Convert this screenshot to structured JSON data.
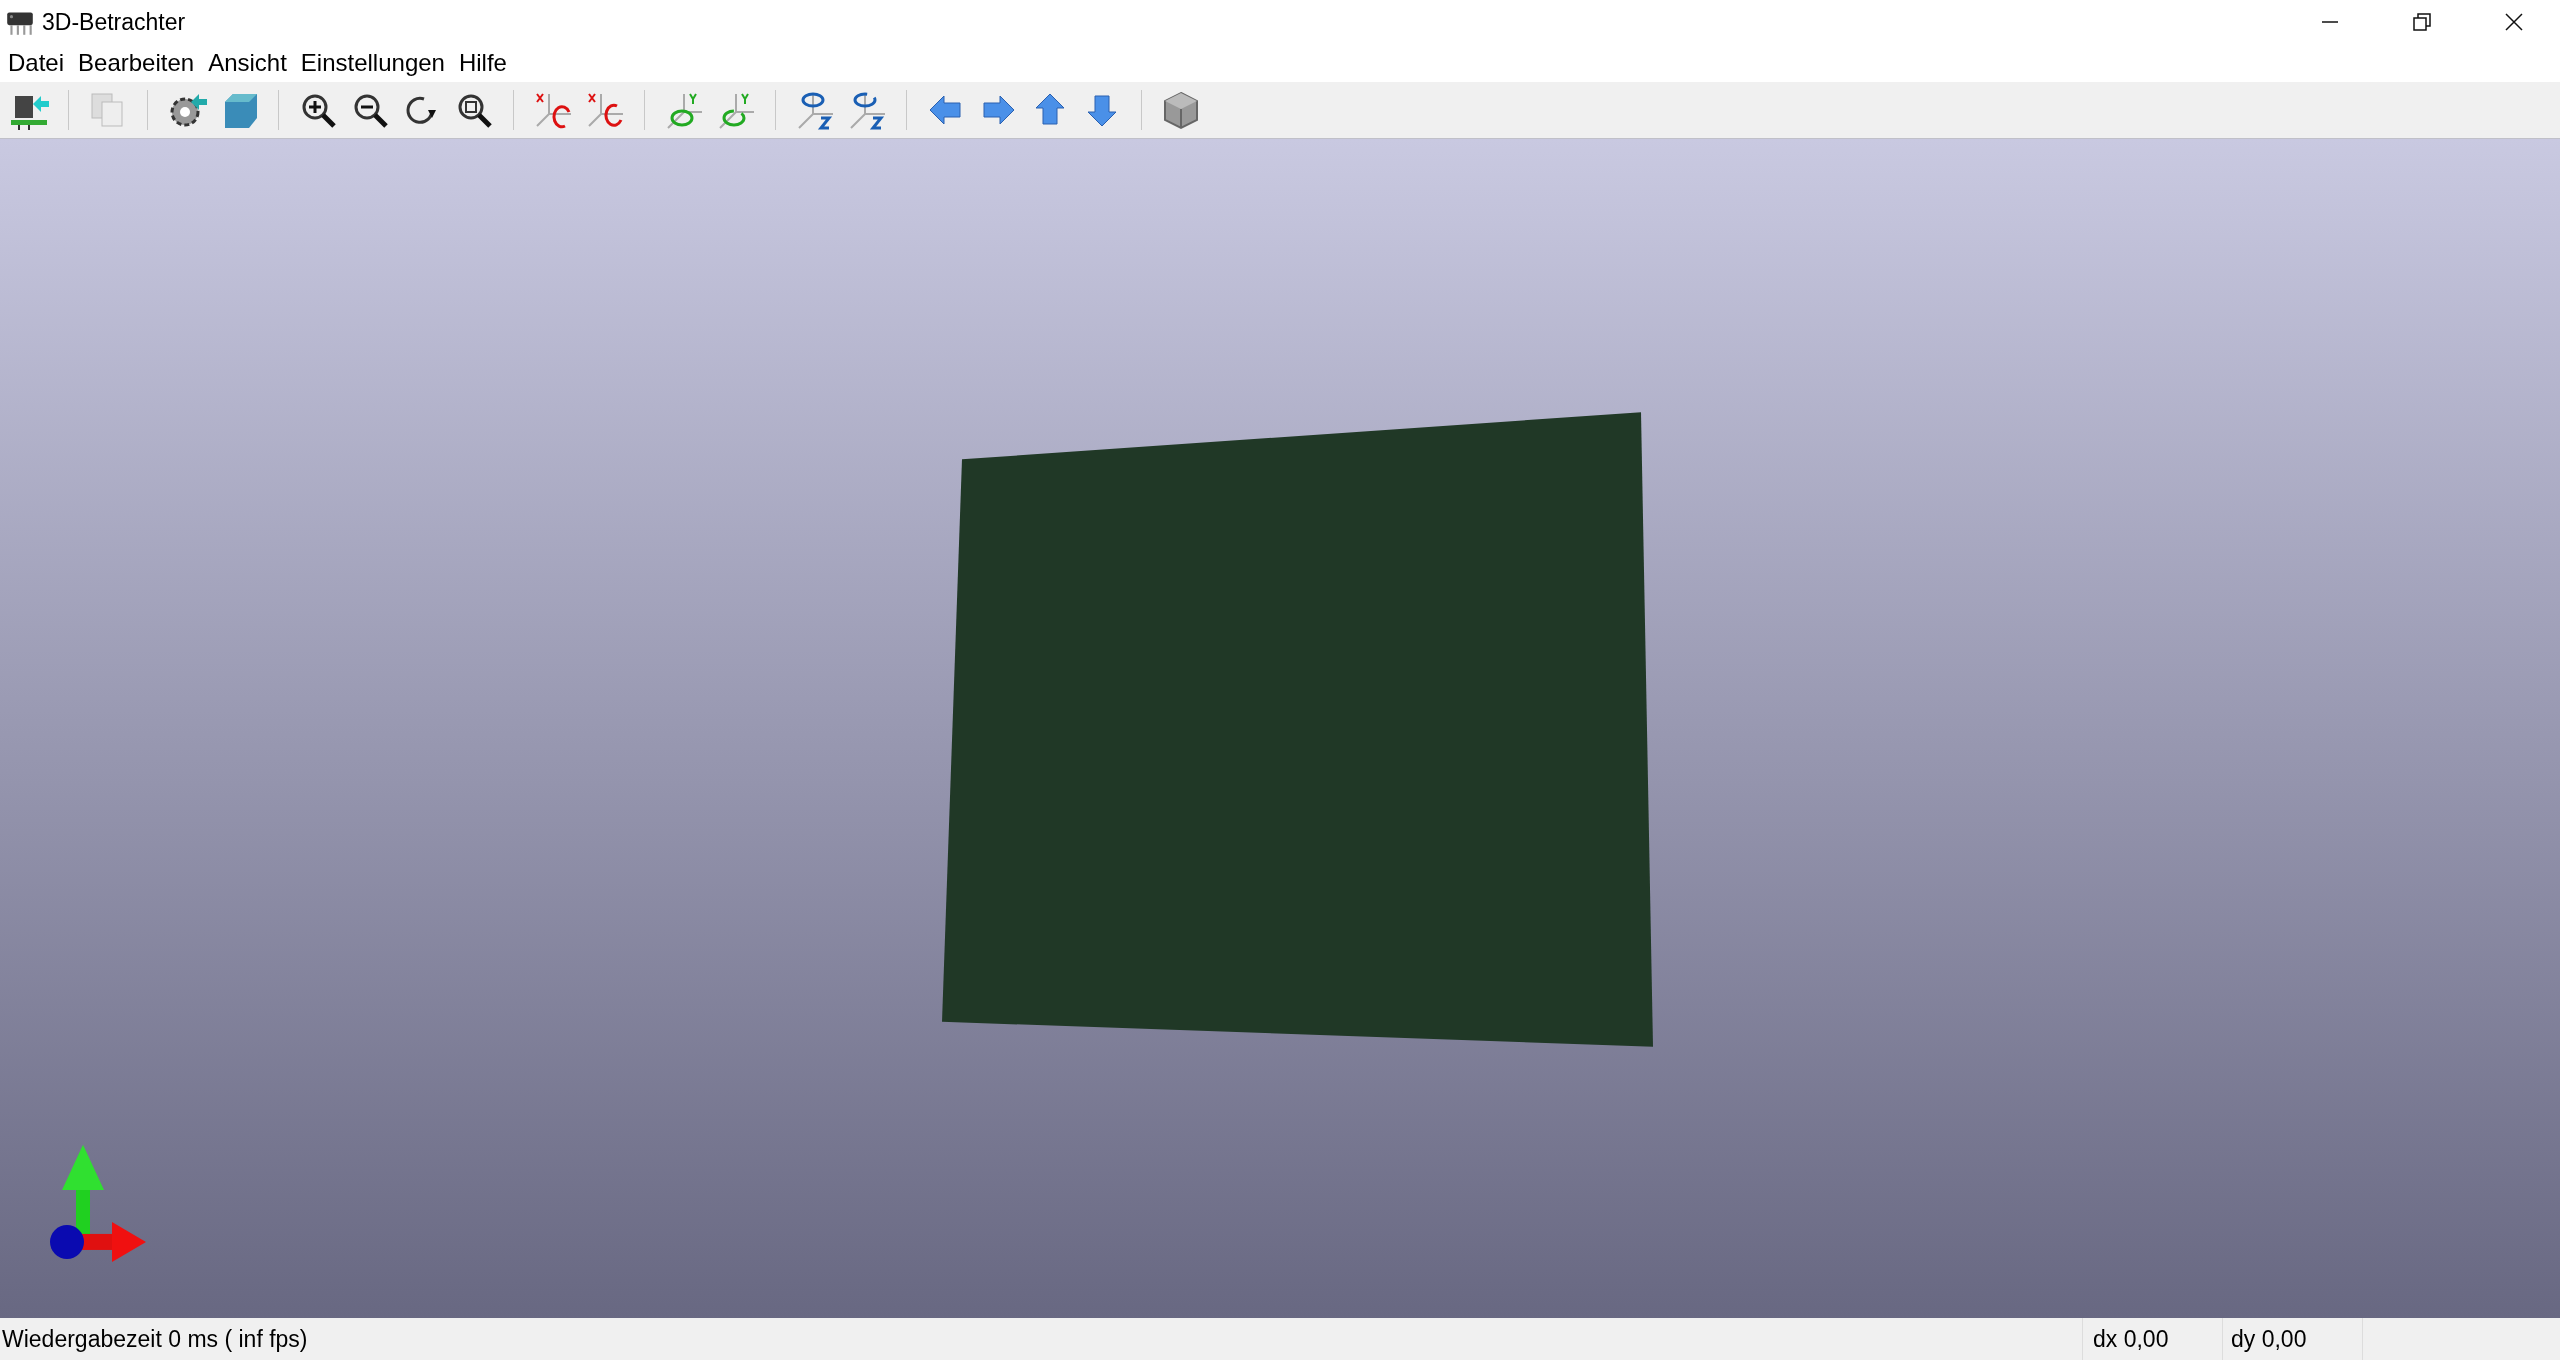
{
  "window": {
    "title": "3D-Betrachter"
  },
  "menu": [
    "Datei",
    "Bearbeiten",
    "Ansicht",
    "Einstellungen",
    "Hilfe"
  ],
  "status_bar": {
    "render_time": "Wiedergabezeit 0 ms ( inf fps)",
    "dx": "dx 0,00",
    "dy": "dy 0,00"
  }
}
